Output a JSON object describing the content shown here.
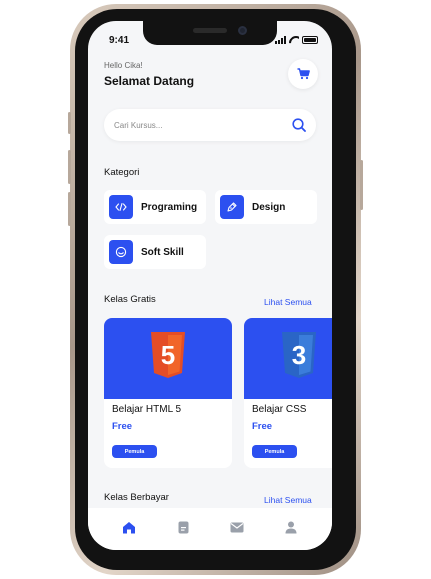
{
  "status_bar": {
    "time": "9:41"
  },
  "header": {
    "greeting": "Hello Cika!",
    "welcome": "Selamat Datang"
  },
  "search": {
    "placeholder": "Cari Kursus..."
  },
  "categories": {
    "title": "Kategori",
    "items": [
      {
        "label": "Programing",
        "icon": "code-icon"
      },
      {
        "label": "Design",
        "icon": "pen-icon"
      },
      {
        "label": "Soft Skill",
        "icon": "smile-icon"
      }
    ]
  },
  "free_classes": {
    "title": "Kelas Gratis",
    "see_all": "Lihat Semua",
    "courses": [
      {
        "title": "Belajar HTML 5",
        "price": "Free",
        "level": "Pemula",
        "logo": "html5-logo",
        "logo_text": "5"
      },
      {
        "title": "Belajar CSS",
        "price": "Free",
        "level": "Pemula",
        "logo": "css3-logo",
        "logo_text": "3"
      }
    ]
  },
  "paid_classes": {
    "title": "Kelas Berbayar",
    "see_all": "Lihat Semua"
  },
  "bottom_nav": [
    "home-icon",
    "document-icon",
    "mail-icon",
    "profile-icon"
  ],
  "colors": {
    "accent": "#2c50f0",
    "html5": "#e44d26",
    "css3": "#2a65c6",
    "background": "#f5f6f8"
  }
}
